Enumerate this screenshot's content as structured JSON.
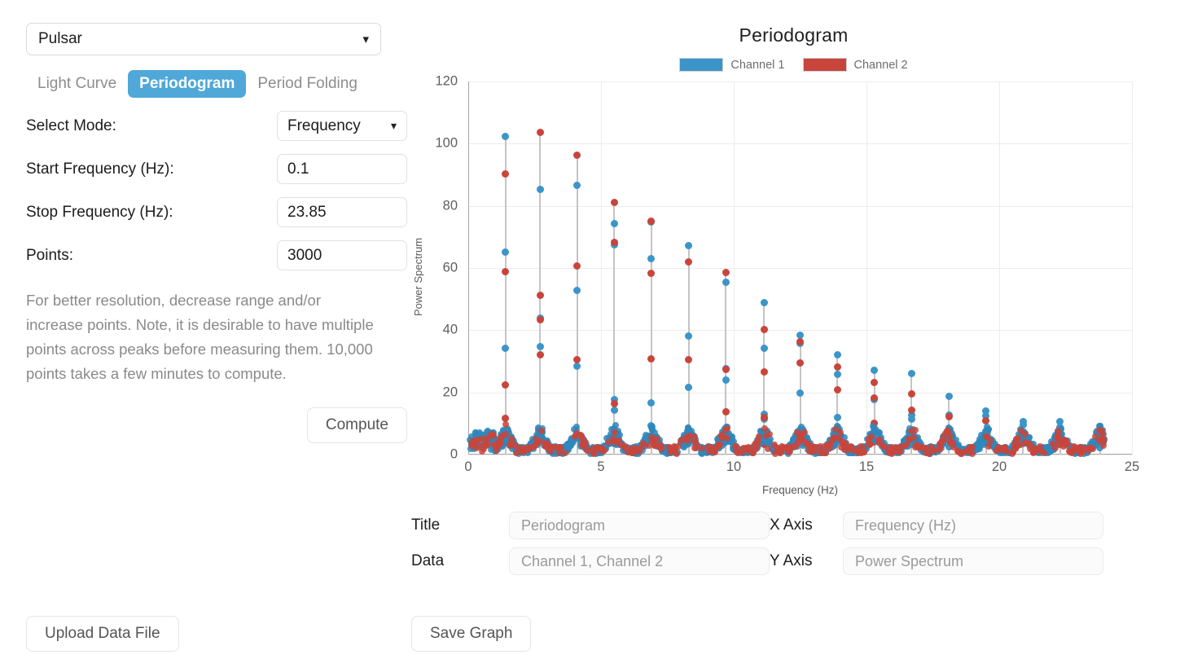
{
  "sidebar": {
    "source_select": {
      "value": "Pulsar",
      "icon": "chevron-down-icon"
    },
    "tabs": [
      {
        "label": "Light Curve",
        "active": false
      },
      {
        "label": "Periodogram",
        "active": true
      },
      {
        "label": "Period Folding",
        "active": false
      }
    ],
    "fields": [
      {
        "label": "Select Mode:",
        "value": "Frequency",
        "type": "select"
      },
      {
        "label": "Start Frequency (Hz):",
        "value": "0.1",
        "type": "text"
      },
      {
        "label": "Stop Frequency (Hz):",
        "value": "23.85",
        "type": "text"
      },
      {
        "label": "Points:",
        "value": "3000",
        "type": "text"
      }
    ],
    "help_text": "For better resolution, decrease range and/or increase points. Note, it is desirable to have multiple points across peaks before measuring them. 10,000 points takes a few minutes to compute.",
    "compute_label": "Compute",
    "upload_label": "Upload Data File"
  },
  "captions": {
    "title_label": "Title",
    "title_placeholder": "Periodogram",
    "data_label": "Data",
    "data_placeholder": "Channel 1, Channel 2",
    "xaxis_label": "X Axis",
    "xaxis_placeholder": "Frequency (Hz)",
    "yaxis_label": "Y Axis",
    "yaxis_placeholder": "Power Spectrum",
    "save_label": "Save Graph"
  },
  "colors": {
    "channel1": "#3c95c8",
    "channel2": "#c8453c",
    "active_tab": "#4fa8d8",
    "grid": "#ececec",
    "stem": "#c4c4c4"
  },
  "chart_data": {
    "type": "scatter",
    "title": "Periodogram",
    "xlabel": "Frequency (Hz)",
    "ylabel": "Power Spectrum",
    "xlim": [
      0,
      25
    ],
    "ylim": [
      0,
      120
    ],
    "xticks": [
      0,
      5,
      10,
      15,
      20,
      25
    ],
    "yticks": [
      0,
      20,
      40,
      60,
      80,
      100,
      120
    ],
    "grid": true,
    "legend_position": "top-center",
    "legend": [
      "Channel 1",
      "Channel 2"
    ],
    "series": [
      {
        "name": "Channel 1",
        "color": "#3c95c8",
        "points": [
          [
            1.4,
            102.3
          ],
          [
            1.4,
            65.0
          ],
          [
            1.4,
            34.2
          ],
          [
            2.7,
            85.3
          ],
          [
            2.7,
            44.0
          ],
          [
            2.7,
            34.6
          ],
          [
            4.1,
            86.5
          ],
          [
            4.1,
            52.8
          ],
          [
            4.1,
            28.4
          ],
          [
            5.5,
            74.4
          ],
          [
            5.5,
            67.5
          ],
          [
            5.5,
            17.8
          ],
          [
            5.5,
            14.4
          ],
          [
            6.9,
            74.9
          ],
          [
            6.9,
            62.9
          ],
          [
            6.9,
            16.7
          ],
          [
            6.9,
            9.2
          ],
          [
            8.3,
            67.3
          ],
          [
            8.3,
            38.0
          ],
          [
            8.3,
            21.5
          ],
          [
            8.3,
            5.2
          ],
          [
            9.7,
            55.4
          ],
          [
            9.7,
            27.6
          ],
          [
            9.7,
            23.9
          ],
          [
            11.15,
            48.8
          ],
          [
            11.15,
            34.1
          ],
          [
            11.15,
            13.0
          ],
          [
            11.15,
            11.3
          ],
          [
            11.15,
            4.2
          ],
          [
            12.5,
            38.3
          ],
          [
            12.5,
            35.8
          ],
          [
            12.5,
            19.9
          ],
          [
            12.5,
            8.0
          ],
          [
            13.9,
            32.0
          ],
          [
            13.9,
            25.7
          ],
          [
            13.9,
            11.8
          ],
          [
            13.9,
            6.8
          ],
          [
            15.3,
            27.2
          ],
          [
            15.3,
            17.7
          ],
          [
            15.3,
            8.4
          ],
          [
            15.3,
            4.5
          ],
          [
            16.7,
            26.0
          ],
          [
            16.7,
            12.7
          ],
          [
            16.7,
            11.3
          ],
          [
            16.7,
            3.3
          ],
          [
            18.1,
            18.7
          ],
          [
            18.1,
            12.8
          ],
          [
            18.1,
            8.3
          ],
          [
            18.1,
            2.6
          ],
          [
            19.5,
            14.0
          ],
          [
            19.5,
            12.5
          ],
          [
            19.5,
            7.5
          ],
          [
            19.5,
            6.2
          ],
          [
            20.9,
            10.5
          ],
          [
            20.9,
            9.6
          ],
          [
            20.9,
            3.5
          ],
          [
            22.3,
            10.5
          ],
          [
            22.3,
            8.9
          ],
          [
            22.3,
            4.3
          ],
          [
            23.8,
            5.8
          ],
          [
            23.8,
            4.0
          ],
          [
            23.8,
            2.3
          ]
        ]
      },
      {
        "name": "Channel 2",
        "color": "#c8453c",
        "points": [
          [
            1.4,
            90.2
          ],
          [
            1.4,
            58.8
          ],
          [
            1.4,
            22.3
          ],
          [
            1.4,
            11.6
          ],
          [
            2.7,
            103.5
          ],
          [
            2.7,
            51.2
          ],
          [
            2.7,
            43.3
          ],
          [
            2.7,
            32.0
          ],
          [
            4.1,
            96.4
          ],
          [
            4.1,
            60.6
          ],
          [
            4.1,
            30.6
          ],
          [
            5.5,
            81.0
          ],
          [
            5.5,
            68.3
          ],
          [
            5.5,
            16.4
          ],
          [
            5.5,
            3.6
          ],
          [
            6.9,
            75.0
          ],
          [
            6.9,
            58.3
          ],
          [
            6.9,
            30.9
          ],
          [
            6.9,
            6.0
          ],
          [
            8.3,
            61.9
          ],
          [
            8.3,
            30.6
          ],
          [
            8.3,
            4.0
          ],
          [
            9.7,
            58.6
          ],
          [
            9.7,
            27.4
          ],
          [
            9.7,
            13.8
          ],
          [
            11.15,
            40.2
          ],
          [
            11.15,
            26.5
          ],
          [
            11.15,
            12.0
          ],
          [
            11.15,
            3.2
          ],
          [
            12.5,
            36.4
          ],
          [
            12.5,
            29.6
          ],
          [
            12.5,
            5.6
          ],
          [
            13.9,
            28.1
          ],
          [
            13.9,
            20.8
          ],
          [
            13.9,
            7.0
          ],
          [
            15.3,
            23.2
          ],
          [
            15.3,
            18.3
          ],
          [
            15.3,
            10.0
          ],
          [
            15.3,
            4.0
          ],
          [
            16.7,
            19.4
          ],
          [
            16.7,
            14.2
          ],
          [
            16.7,
            7.0
          ],
          [
            18.1,
            12.3
          ],
          [
            18.1,
            8.1
          ],
          [
            18.1,
            4.6
          ],
          [
            19.5,
            10.8
          ],
          [
            19.5,
            6.3
          ],
          [
            19.5,
            3.9
          ],
          [
            20.9,
            7.2
          ],
          [
            20.9,
            4.3
          ],
          [
            22.3,
            6.4
          ],
          [
            22.3,
            3.2
          ],
          [
            23.8,
            6.2
          ],
          [
            23.8,
            4.6
          ]
        ]
      }
    ],
    "noise_floor": {
      "description": "dense low-amplitude scatter along baseline for both channels",
      "y_range": [
        0,
        10
      ]
    }
  }
}
